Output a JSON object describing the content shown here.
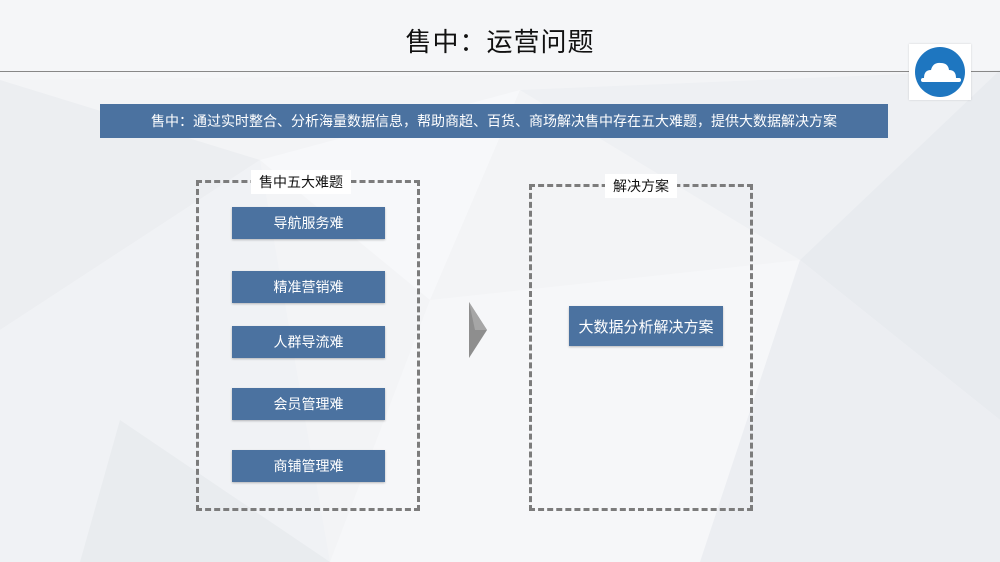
{
  "slide": {
    "title": "售中：运营问题",
    "banner": "售中：通过实时整合、分析海量数据信息，帮助商超、百货、商场解决售中存在五大难题，提供大数据解决方案"
  },
  "left_panel": {
    "label": "售中五大难题",
    "items": [
      "导航服务难",
      "精准营销难",
      "人群导流难",
      "会员管理难",
      "商铺管理难"
    ]
  },
  "right_panel": {
    "label": "解决方案",
    "solution": "大数据分析解决方案"
  },
  "colors": {
    "accent": "#4b72a0",
    "logo": "#1e76c0",
    "dash": "#7c7c7c",
    "arrow": "#8e8e8e"
  },
  "icons": {
    "logo": "cloud-logo-icon",
    "arrow": "right-arrow-icon"
  }
}
